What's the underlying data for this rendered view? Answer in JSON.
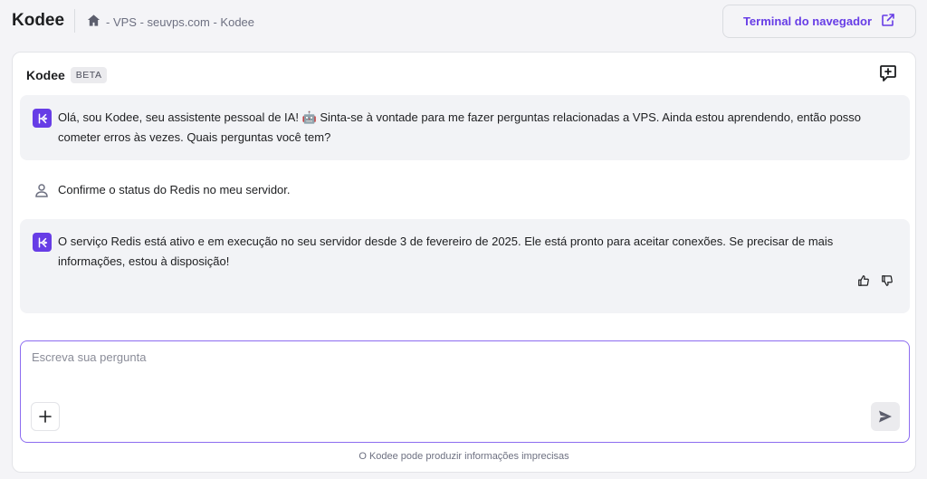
{
  "header": {
    "app_title": "Kodee",
    "breadcrumb": "- VPS - seuvps.com - Kodee",
    "terminal_button": "Terminal do navegador"
  },
  "chat": {
    "title": "Kodee",
    "badge": "BETA",
    "messages": [
      {
        "role": "assistant",
        "text": "Olá, sou Kodee, seu assistente pessoal de IA! 🤖 Sinta-se à vontade para me fazer perguntas relacionadas a VPS. Ainda estou aprendendo, então posso cometer erros às vezes. Quais perguntas você tem?"
      },
      {
        "role": "user",
        "text": "Confirme o status do Redis no meu servidor."
      },
      {
        "role": "assistant",
        "text": "O serviço Redis está ativo e em execução no seu servidor desde 3 de fevereiro de 2025. Ele está pronto para aceitar conexões. Se precisar de mais informações, estou à disposição!"
      }
    ],
    "input_placeholder": "Escreva sua pergunta",
    "disclaimer": "O Kodee pode produzir informações imprecisas"
  },
  "icons": {
    "home": "home-icon",
    "external": "external-link-icon",
    "new_chat": "new-chat-icon",
    "bot": "kodee-logo-icon",
    "user": "user-icon",
    "like": "thumbs-up-icon",
    "dislike": "thumbs-down-icon",
    "plus": "plus-icon",
    "send": "send-icon"
  },
  "colors": {
    "accent": "#673de6",
    "bot_bubble": "#f2f3f6",
    "input_border": "#8c6cf0"
  }
}
